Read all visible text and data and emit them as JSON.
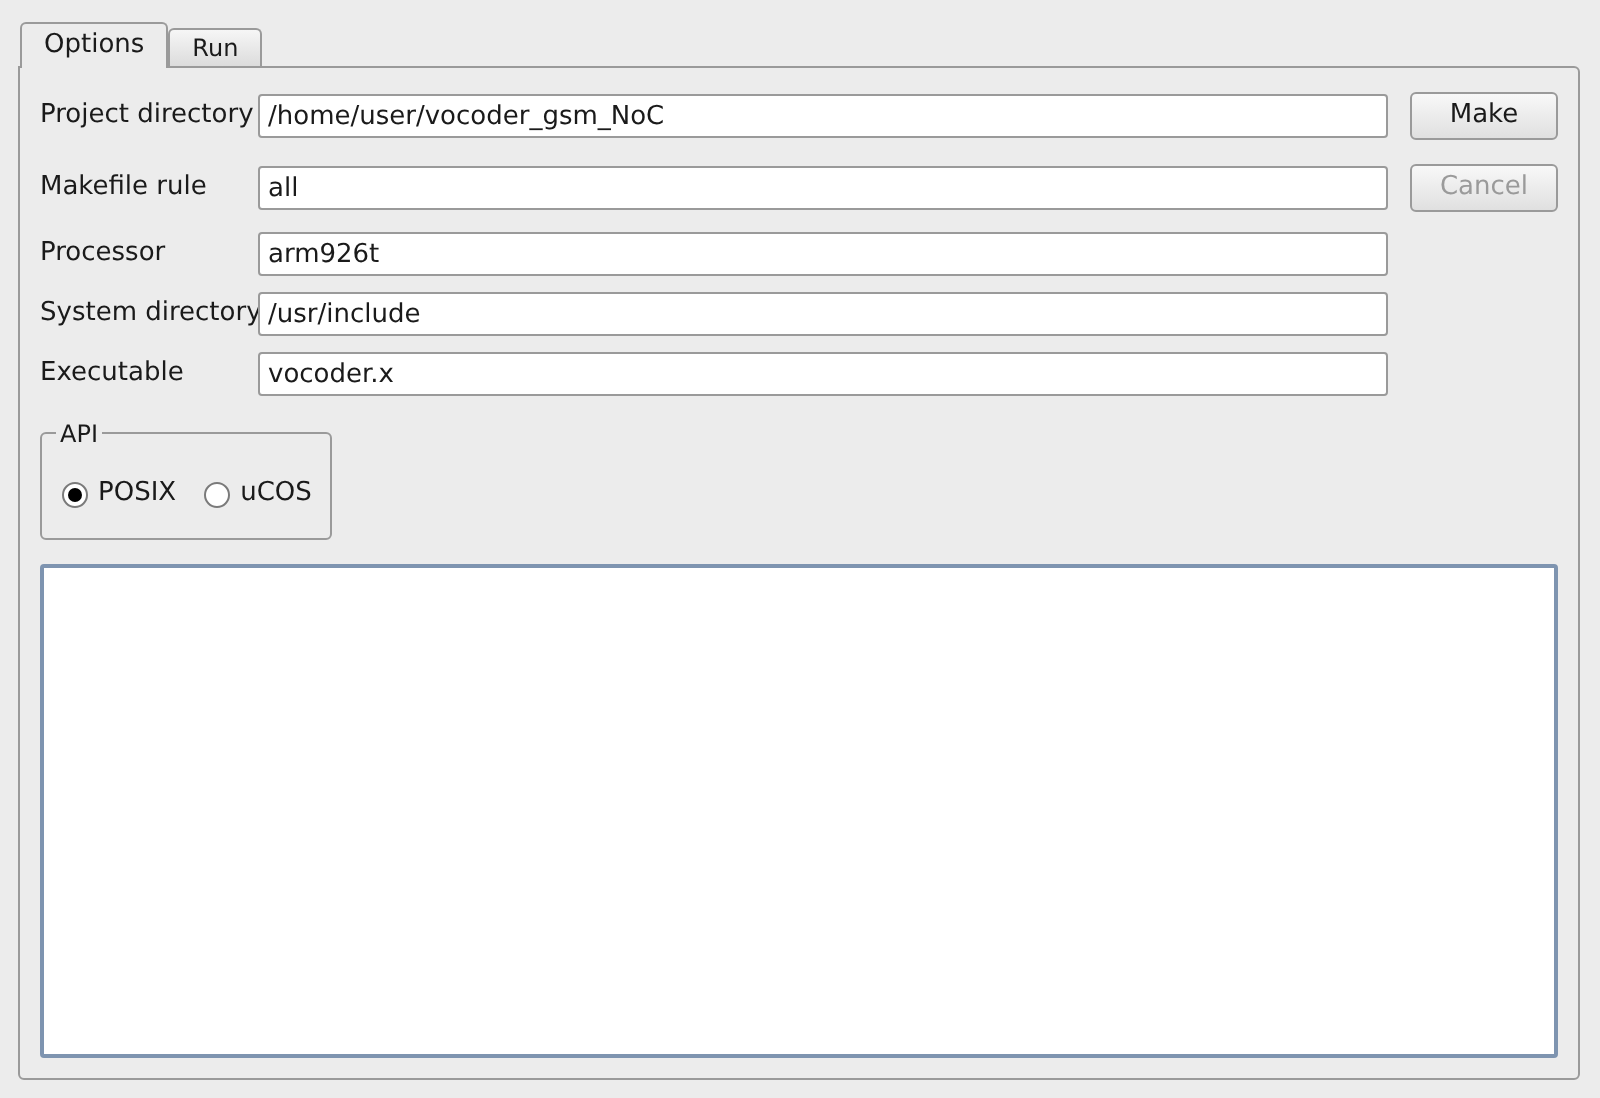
{
  "tabs": [
    {
      "label": "Options",
      "selected": true
    },
    {
      "label": "Run",
      "selected": false
    }
  ],
  "fields": [
    {
      "label": "Project directory",
      "value": "/home/user/vocoder_gsm_NoC",
      "button": {
        "label": "Make",
        "disabled": false
      }
    },
    {
      "label": "Makefile rule",
      "value": "all",
      "button": {
        "label": "Cancel",
        "disabled": true
      }
    },
    {
      "label": "Processor",
      "value": "arm926t"
    },
    {
      "label": "System directory",
      "value": "/usr/include"
    },
    {
      "label": "Executable",
      "value": "vocoder.x"
    }
  ],
  "api": {
    "title": "API",
    "options": [
      {
        "label": "POSIX",
        "selected": true
      },
      {
        "label": "uCOS",
        "selected": false
      }
    ]
  }
}
